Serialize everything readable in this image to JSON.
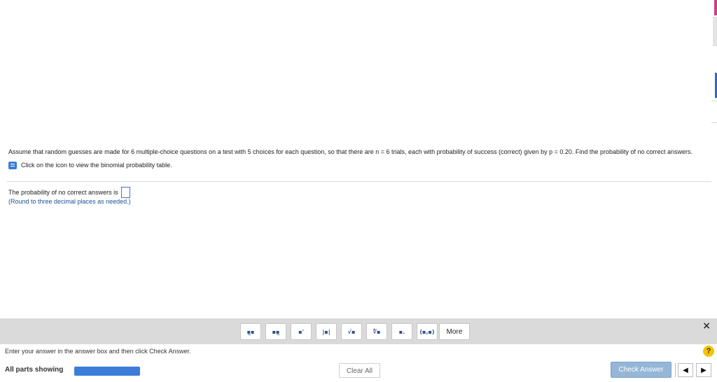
{
  "question": {
    "text": "Assume that random guesses are made for 6 multiple-choice questions on a test with 5 choices for each question, so that there are n = 6 trials, each with probability of success (correct) given by p = 0.20. Find the probability of no correct answers.",
    "binomial_link": "Click on the icon to view the binomial probability table.",
    "answer_prompt": "The probability of no correct answers is",
    "answer_value": "",
    "round_note": "(Round to three decimal places as needed.)"
  },
  "toolbar": {
    "buttons": [
      {
        "name": "fraction",
        "glyph": "▪̲▪"
      },
      {
        "name": "mixed-number",
        "glyph": "▪▪̲"
      },
      {
        "name": "exponent",
        "glyph": "▪'"
      },
      {
        "name": "absolute-value",
        "glyph": "|▪|"
      },
      {
        "name": "square-root",
        "glyph": "√▪"
      },
      {
        "name": "nth-root",
        "glyph": "∜▪"
      },
      {
        "name": "decimal",
        "glyph": "▪."
      },
      {
        "name": "ordered-pair",
        "glyph": "(▪,▪)"
      }
    ],
    "more_label": "More",
    "close_glyph": "×"
  },
  "instruction": "Enter your answer in the answer box and then click Check Answer.",
  "help_glyph": "?",
  "footer": {
    "parts_label": "All parts showing",
    "progress_pct": 100,
    "clear_label": "Clear All",
    "check_label": "Check Answer",
    "prev_glyph": "◀",
    "next_glyph": "▶"
  },
  "colors": {
    "accent": "#3b7dd8",
    "toolbar_bg": "#dadada",
    "check_button": "#95b6d7",
    "help": "#f3c400"
  }
}
